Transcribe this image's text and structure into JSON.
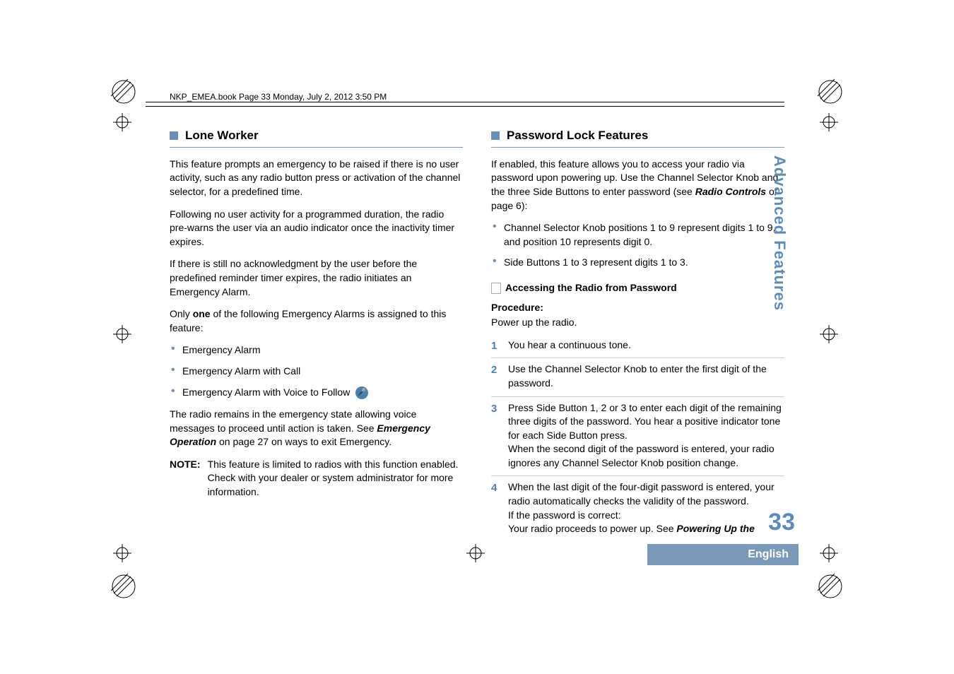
{
  "header": "NKP_EMEA.book  Page 33  Monday, July 2, 2012  3:50 PM",
  "sidebar": {
    "section_title": "Advanced Features",
    "page_number": "33",
    "language": "English"
  },
  "left": {
    "heading": "Lone Worker",
    "p1": "This feature prompts an emergency to be raised if there is no user activity, such as any radio button press or activation of the channel selector, for a predefined time.",
    "p2": "Following no user activity for a programmed duration, the radio pre-warns the user via an audio indicator once the inactivity timer expires.",
    "p3": "If there is still no acknowledgment by the user before the predefined reminder timer expires, the radio initiates an Emergency Alarm.",
    "p4_a": "Only ",
    "p4_b": "one",
    "p4_c": " of the following Emergency Alarms is assigned to this feature:",
    "bullets": [
      "Emergency Alarm",
      "Emergency Alarm with Call",
      "Emergency Alarm with Voice to Follow"
    ],
    "p5_a": "The radio remains in the emergency state allowing voice messages to proceed until action is taken. See ",
    "p5_b": "Emergency Operation",
    "p5_c": " on page 27 on ways to exit Emergency.",
    "note_label": "NOTE:",
    "note_text": "This feature is limited to radios with this function enabled. Check with your dealer or system administrator for more information."
  },
  "right": {
    "heading": "Password Lock Features",
    "p1_a": "If enabled, this feature allows you to access your radio via password upon powering up. Use the Channel Selector Knob and the three Side Buttons to enter password (see ",
    "p1_b": "Radio Controls",
    "p1_c": " of page 6):",
    "bullets": [
      "Channel Selector Knob positions 1 to 9 represent digits 1 to 9, and position 10 represents digit 0.",
      "Side Buttons 1 to 3 represent digits 1 to 3."
    ],
    "subheading": "Accessing the Radio from Password",
    "proc_label": "Procedure:",
    "proc_intro": "Power up the radio.",
    "steps": {
      "s1": "You hear a continuous tone.",
      "s2": "Use the Channel Selector Knob to enter the first digit of the password.",
      "s3": "Press Side Button 1, 2 or 3 to enter each digit of the remaining three digits of the password. You hear a positive indicator tone for each Side Button press.\nWhen the second digit of the password is entered, your radio ignores any Channel Selector Knob position change.",
      "s4_a": "When the last digit of the four-digit password is entered, your radio automatically checks the validity of the password.\nIf the password is correct:\nYour radio proceeds to power up. See ",
      "s4_b": "Powering Up the"
    }
  }
}
